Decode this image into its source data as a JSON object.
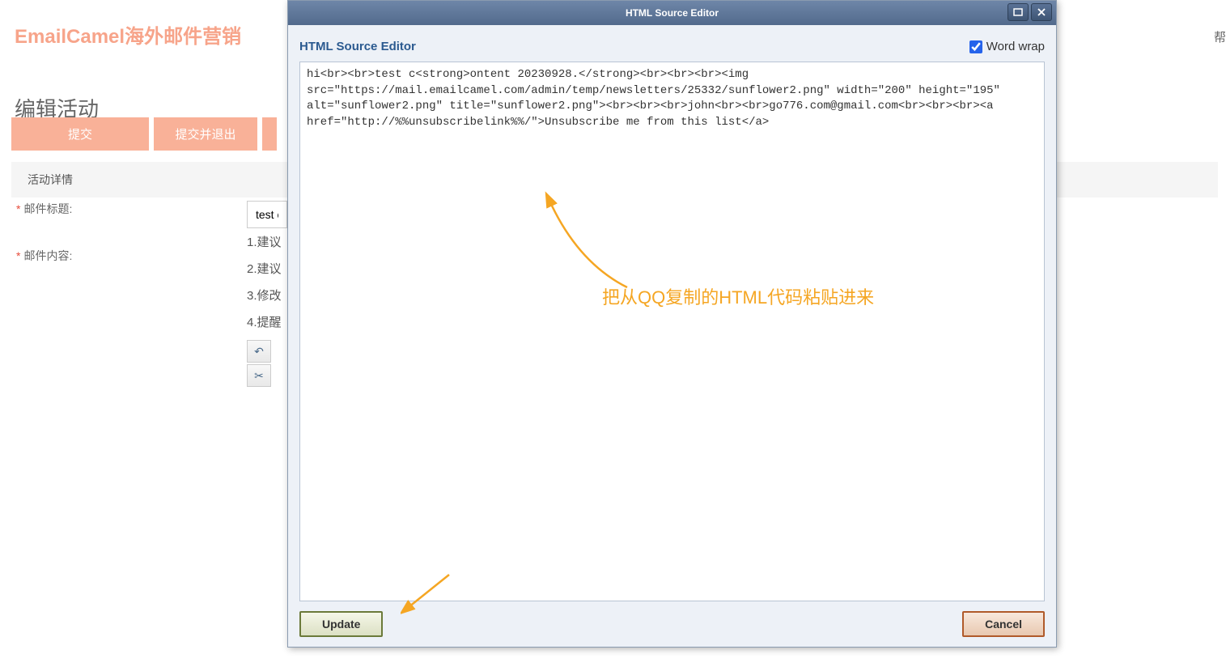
{
  "logo": "EmailCamel海外邮件营销",
  "help": "帮",
  "page_title": "编辑活动",
  "buttons": {
    "submit": "提交",
    "submit_exit": "提交并退出"
  },
  "section_header": "活动详情",
  "labels": {
    "mail_title": "邮件标题:",
    "mail_content": "邮件内容:"
  },
  "title_value": "test c",
  "tips": [
    "1.建议",
    "2.建议",
    "3.修改",
    "4.提醒"
  ],
  "dialog": {
    "title": "HTML Source Editor",
    "subtitle": "HTML Source Editor",
    "wordwrap": "Word wrap",
    "wordwrap_checked": true,
    "source": "hi<br><br>test c<strong>ontent 20230928.</strong><br><br><br><img src=\"https://mail.emailcamel.com/admin/temp/newsletters/25332/sunflower2.png\" width=\"200\" height=\"195\" alt=\"sunflower2.png\" title=\"sunflower2.png\"><br><br><br>john<br><br>go776.com@gmail.com<br><br><br><a href=\"http://%%unsubscribelink%%/\">Unsubscribe me from this list</a>",
    "update": "Update",
    "cancel": "Cancel"
  },
  "annotation": "把从QQ复制的HTML代码粘贴进来"
}
